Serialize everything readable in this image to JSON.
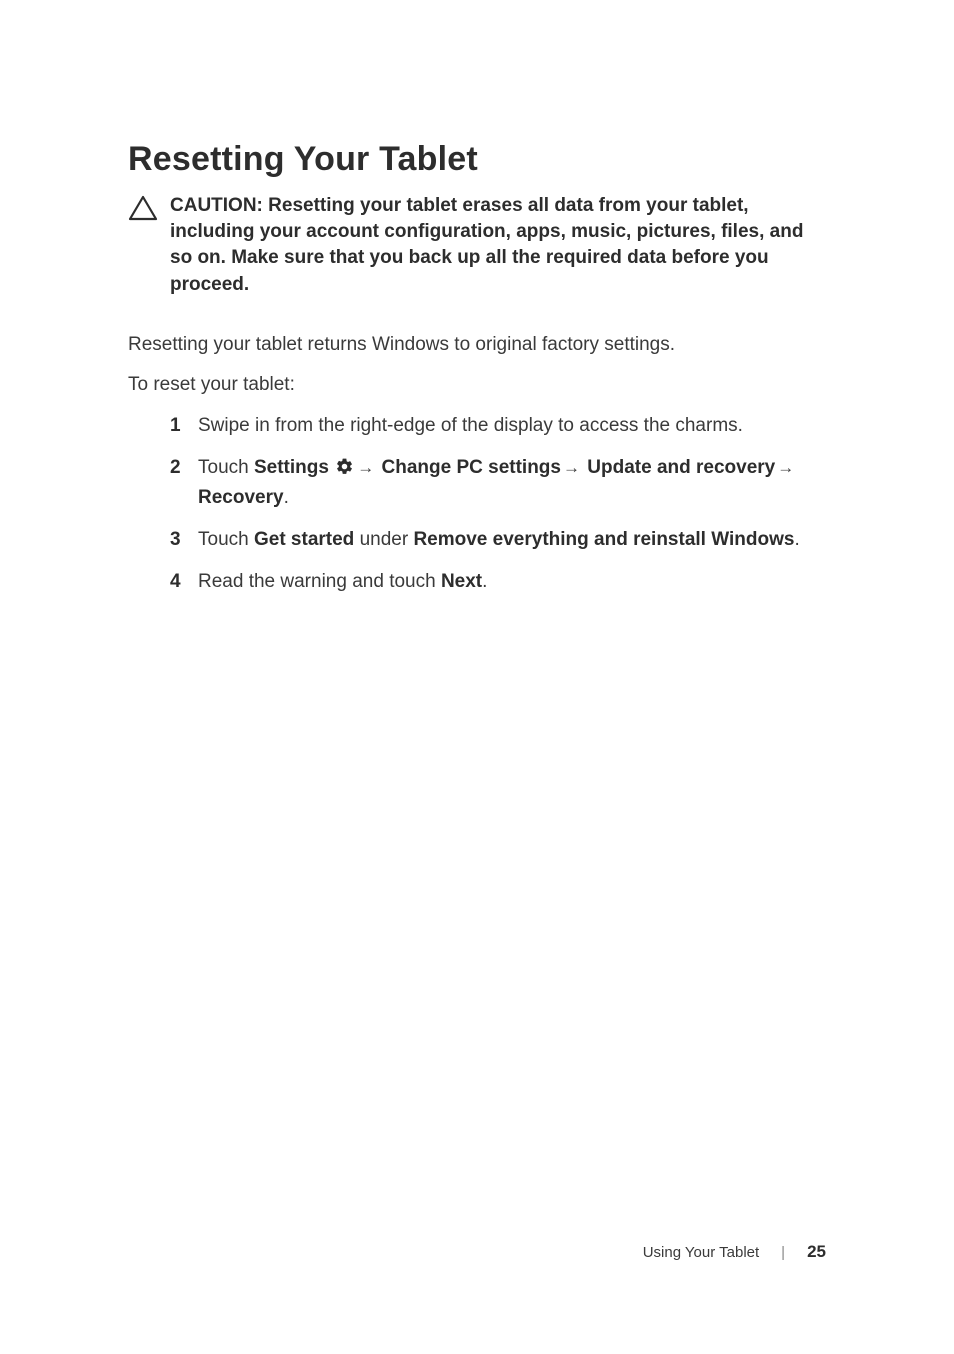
{
  "heading": "Resetting Your Tablet",
  "caution": "CAUTION: Resetting your tablet erases all data from your tablet, including your account configuration, apps, music, pictures, files, and so on. Make sure that you back up all the required data before you proceed.",
  "para1": "Resetting your tablet returns Windows to original factory settings.",
  "para2": "To reset your tablet:",
  "steps": {
    "s1": {
      "num": "1",
      "text": "Swipe in from the right-edge of the display to access the charms."
    },
    "s2": {
      "num": "2",
      "t1": "Touch ",
      "settings": "Settings",
      "t2": " ",
      "changepc": "Change PC settings",
      "update": "Update and recovery",
      "recovery": "Recovery",
      "period": "."
    },
    "s3": {
      "num": "3",
      "t1": "Touch ",
      "getstarted": "Get started",
      "t2": " under ",
      "remove": "Remove everything and reinstall Windows",
      "period": "."
    },
    "s4": {
      "num": "4",
      "t1": "Read the warning and touch ",
      "next": "Next",
      "period": "."
    }
  },
  "arrow": "→",
  "footer": {
    "section": "Using Your Tablet",
    "divider": "|",
    "page": "25"
  }
}
